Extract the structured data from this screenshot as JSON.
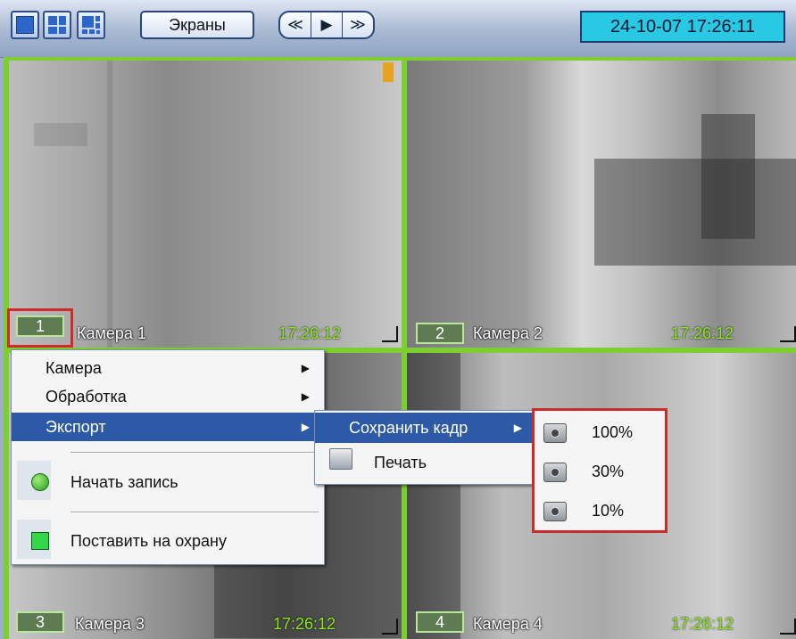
{
  "toolbar": {
    "screens_label": "Экраны",
    "nav": {
      "first": "≪",
      "play": "▶",
      "last": "≫"
    },
    "datetime": "24-10-07  17:26:11"
  },
  "cameras": [
    {
      "num": "1",
      "name": "Камера 1",
      "time": "17:26:12"
    },
    {
      "num": "2",
      "name": "Камера 2",
      "time": "17:26:12"
    },
    {
      "num": "3",
      "name": "Камера 3",
      "time": "17:26:12"
    },
    {
      "num": "4",
      "name": "Камера 4",
      "time": "17:26:12"
    }
  ],
  "context_menu": {
    "items": [
      {
        "label": "Камера"
      },
      {
        "label": "Обработка"
      },
      {
        "label": "Экспорт"
      },
      {
        "label": "Начать запись"
      },
      {
        "label": "Поставить на охрану"
      }
    ],
    "arrow": "▶"
  },
  "export_menu": {
    "items": [
      {
        "label": "Сохранить кадр"
      },
      {
        "label": "Печать"
      }
    ]
  },
  "save_frame_menu": {
    "items": [
      {
        "label": "100%"
      },
      {
        "label": "30%"
      },
      {
        "label": "10%"
      }
    ]
  }
}
